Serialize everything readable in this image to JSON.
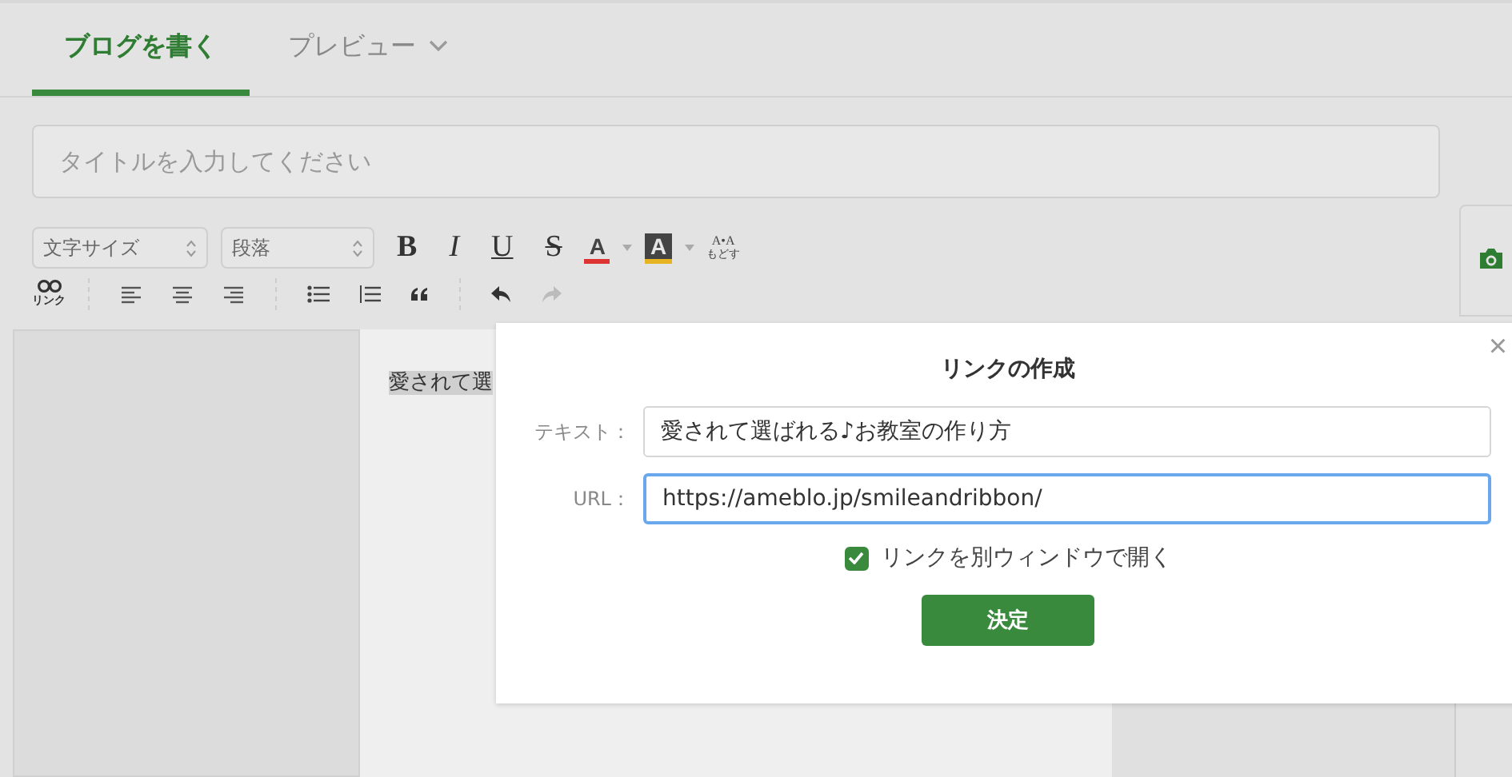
{
  "tabs": [
    {
      "label": "ブログを書く",
      "selected": true,
      "kind": "plain"
    },
    {
      "label": "プレビュー",
      "selected": false,
      "kind": "dropdown"
    }
  ],
  "title_field": {
    "placeholder": "タイトルを入力してください"
  },
  "toolbar": {
    "selects": [
      "文字サイズ",
      "段落"
    ],
    "format_buttons": [
      {
        "label": "B",
        "kind": "bold"
      },
      {
        "label": "I",
        "kind": "italic"
      },
      {
        "label": "U",
        "kind": "underline"
      },
      {
        "label": "S",
        "kind": "strike"
      },
      {
        "label": "A",
        "kind": "color"
      },
      {
        "label": "A",
        "kind": "highlight"
      }
    ],
    "clear_format": {
      "label": "A•A",
      "sublabel": "もどす"
    },
    "link_button": {
      "label": "リンク"
    }
  },
  "editor": {
    "text": "愛されて選"
  },
  "dialog": {
    "title": "リンクの作成",
    "close": "×",
    "fields": [
      {
        "label": "テキスト：",
        "value": "愛されて選ばれる♪お教室の作り方",
        "focused": false
      },
      {
        "label": "URL：",
        "value": "https://ameblo.jp/smileandribbon/",
        "focused": true
      }
    ],
    "checkbox": {
      "label": "リンクを別ウィンドウで開く",
      "checked": true
    },
    "submit": "決定"
  }
}
